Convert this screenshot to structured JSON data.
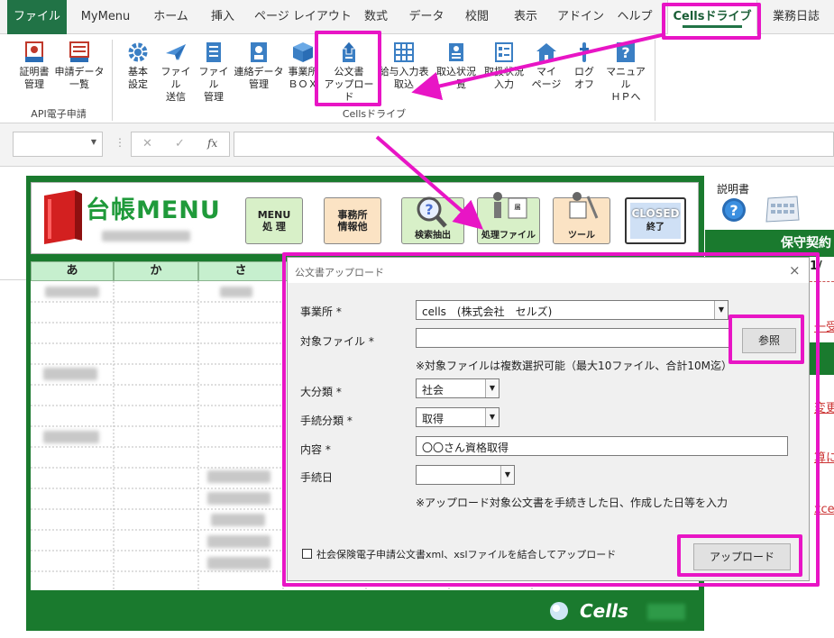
{
  "ribbon_tabs": [
    "ファイル",
    "MyMenu",
    "ホーム",
    "挿入",
    "ページ レイアウト",
    "数式",
    "データ",
    "校閲",
    "表示",
    "アドイン",
    "ヘルプ",
    "Cellsドライブ",
    "業務日誌"
  ],
  "ribbon": {
    "api_group_label": "API電子申請",
    "api_buttons": [
      {
        "line1": "証明書",
        "line2": "管理",
        "icon": "certificate-icon"
      },
      {
        "line1": "申請データ",
        "line2": "一覧",
        "icon": "application-data-icon"
      }
    ],
    "cells_group_label": "Cellsドライブ",
    "cells_buttons": [
      {
        "line1": "基本",
        "line2": "設定",
        "icon": "gear-icon"
      },
      {
        "line1": "ファイル",
        "line2": "送信",
        "icon": "paper-plane-icon"
      },
      {
        "line1": "ファイル",
        "line2": "管理",
        "icon": "file-manage-icon"
      },
      {
        "line1": "連絡データ",
        "line2": "管理",
        "icon": "contact-data-icon"
      },
      {
        "line1": "事業所",
        "line2": "ＢＯＸ",
        "icon": "box-icon"
      },
      {
        "line1": "公文書",
        "line2": "アップロード",
        "icon": "upload-icon"
      },
      {
        "line1": "給与入力表",
        "line2": "取込",
        "icon": "salary-table-icon"
      },
      {
        "line1": "取込状況",
        "line2": "一覧",
        "icon": "import-status-icon"
      },
      {
        "line1": "取扱状況",
        "line2": "入力",
        "icon": "handling-status-icon"
      },
      {
        "line1": "マイ",
        "line2": "ページ",
        "icon": "home-icon"
      },
      {
        "line1": "ログ",
        "line2": "オフ",
        "icon": "logoff-icon"
      },
      {
        "line1": "マニュアル",
        "line2": "ＨＰへ",
        "icon": "help-icon"
      }
    ]
  },
  "formula_bar": {
    "fx": "fx",
    "cancel": "✕",
    "confirm": "✓"
  },
  "sheet": {
    "title": "台帳MENU",
    "menu_buttons": [
      {
        "line1": "MENU",
        "line2": "処 理"
      },
      {
        "line1": "事務所",
        "line2": "情報他"
      },
      {
        "line1": "検索抽出",
        "line2": ""
      },
      {
        "line1": "処理ファイル",
        "line2": ""
      },
      {
        "line1": "ツール",
        "line2": ""
      },
      {
        "line1": "CLOSED",
        "line2": "終了"
      }
    ],
    "grid_headers": [
      "あ",
      "か",
      "さ"
    ],
    "footer_brand": "Cells",
    "manual_label": "説明書",
    "right_header": "保守契約",
    "right_fragments": [
      "1/",
      "一受",
      "変更",
      "算に",
      "xce"
    ]
  },
  "dialog": {
    "title": "公文書アップロード",
    "close": "×",
    "office_label": "事業所 *",
    "office_value": "cells　(株式会社　セルズ)",
    "file_label": "対象ファイル *",
    "file_value": "",
    "browse_button": "参照",
    "file_note": "※対象ファイルは複数選択可能（最大10ファイル、合計10M迄）",
    "category_label": "大分類 *",
    "category_value": "社会",
    "procedure_label": "手続分類 *",
    "procedure_value": "取得",
    "content_label": "内容 *",
    "content_value": "〇〇さん資格取得",
    "date_label": "手続日",
    "date_value": "",
    "date_note": "※アップロード対象公文書を手続きした日、作成した日等を入力",
    "merge_checkbox_label": "社会保険電子申請公文書xml、xslファイルを結合してアップロード",
    "merge_checked": false,
    "upload_button": "アップロード"
  }
}
